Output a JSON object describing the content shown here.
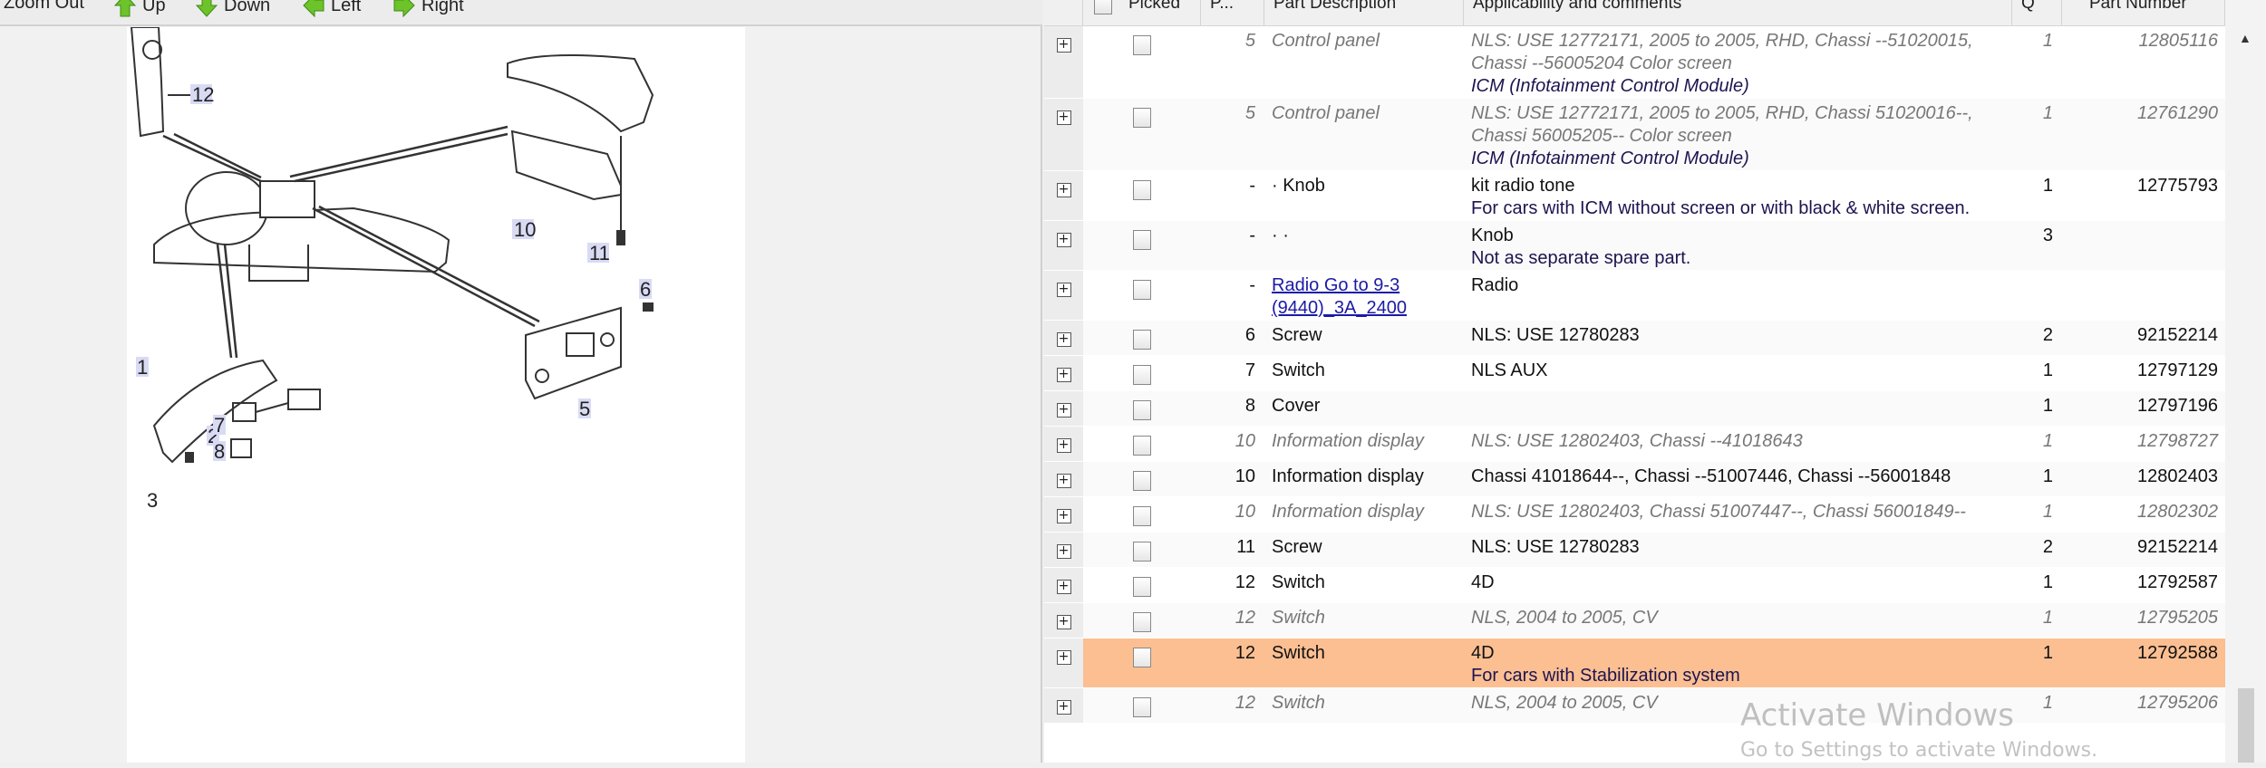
{
  "toolbar": {
    "zoom_out": "Zoom Out",
    "up": "Up",
    "down": "Down",
    "left": "Left",
    "right": "Right",
    "arrow_color": "#6cc32a"
  },
  "diagram": {
    "callouts": [
      "12",
      "10",
      "11",
      "6",
      "1",
      "2",
      "5",
      "7",
      "8",
      "3"
    ]
  },
  "table": {
    "headers": {
      "picked": "Picked",
      "pos": "P...",
      "desc": "Part Description",
      "applicability": "Applicability and comments",
      "qty": "Q",
      "part_number": "Part Number"
    },
    "rows": [
      {
        "pos": "5",
        "desc": "Control panel",
        "app": "NLS: USE 12772171, 2005 to 2005, RHD, Chassi --51020015, Chassi --56005204 Color screen",
        "comment": "ICM (Infotainment Control Module)",
        "qty": "1",
        "pn": "12805116",
        "style": "ital"
      },
      {
        "pos": "5",
        "desc": "Control panel",
        "app": "NLS: USE 12772171, 2005 to 2005, RHD, Chassi 51020016--, Chassi 56005205-- Color screen",
        "comment": "ICM (Infotainment Control Module)",
        "qty": "1",
        "pn": "12761290",
        "style": "ital"
      },
      {
        "pos": "-",
        "desc": "· Knob",
        "app": "kit radio tone",
        "comment": "For cars with ICM without screen or with black & white screen.",
        "qty": "1",
        "pn": "12775793",
        "style": ""
      },
      {
        "pos": "-",
        "desc": "· ·",
        "app": "Knob",
        "comment": "Not as separate spare part.",
        "qty": "3",
        "pn": "",
        "style": ""
      },
      {
        "pos": "-",
        "desc": "Radio Go to 9-3 (9440)_3A_2400",
        "app": "Radio",
        "comment": "",
        "qty": "",
        "pn": "",
        "style": "link"
      },
      {
        "pos": "6",
        "desc": "Screw",
        "app": "NLS: USE 12780283",
        "comment": "",
        "qty": "2",
        "pn": "92152214",
        "style": ""
      },
      {
        "pos": "7",
        "desc": "Switch",
        "app": "NLS AUX",
        "comment": "",
        "qty": "1",
        "pn": "12797129",
        "style": ""
      },
      {
        "pos": "8",
        "desc": "Cover",
        "app": "",
        "comment": "",
        "qty": "1",
        "pn": "12797196",
        "style": ""
      },
      {
        "pos": "10",
        "desc": "Information display",
        "app": "NLS: USE 12802403, Chassi --41018643",
        "comment": "",
        "qty": "1",
        "pn": "12798727",
        "style": "ital"
      },
      {
        "pos": "10",
        "desc": "Information display",
        "app": "Chassi 41018644--, Chassi --51007446, Chassi --56001848",
        "comment": "",
        "qty": "1",
        "pn": "12802403",
        "style": ""
      },
      {
        "pos": "10",
        "desc": "Information display",
        "app": "NLS: USE 12802403, Chassi 51007447--, Chassi 56001849--",
        "comment": "",
        "qty": "1",
        "pn": "12802302",
        "style": "ital"
      },
      {
        "pos": "11",
        "desc": "Screw",
        "app": "NLS: USE 12780283",
        "comment": "",
        "qty": "2",
        "pn": "92152214",
        "style": ""
      },
      {
        "pos": "12",
        "desc": "Switch",
        "app": "4D",
        "comment": "",
        "qty": "1",
        "pn": "12792587",
        "style": ""
      },
      {
        "pos": "12",
        "desc": "Switch",
        "app": "NLS, 2004 to 2005, CV",
        "comment": "",
        "qty": "1",
        "pn": "12795205",
        "style": "ital"
      },
      {
        "pos": "12",
        "desc": "Switch",
        "app": "4D",
        "comment": "For cars with Stabilization system",
        "qty": "1",
        "pn": "12792588",
        "style": "hl"
      },
      {
        "pos": "12",
        "desc": "Switch",
        "app": "NLS, 2004 to 2005, CV",
        "comment": "",
        "qty": "1",
        "pn": "12795206",
        "style": "ital"
      }
    ]
  },
  "watermark": {
    "title": "Activate Windows",
    "subtitle": "Go to Settings to activate Windows."
  },
  "colors": {
    "highlight_row": "#fbbf92",
    "comment_text": "#1d1450",
    "link": "#1a1aa6"
  }
}
